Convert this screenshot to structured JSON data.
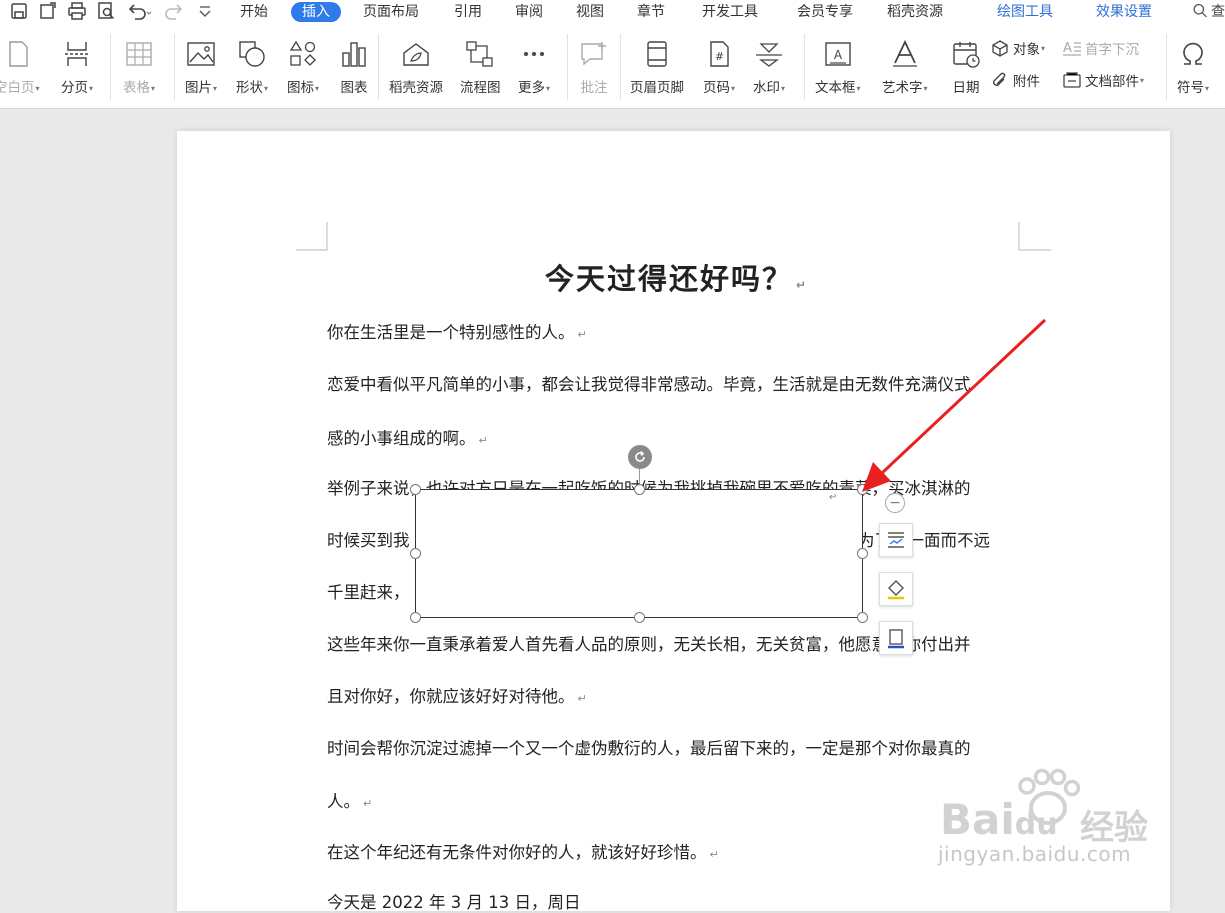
{
  "tabs": [
    "开始",
    "插入",
    "页面布局",
    "引用",
    "审阅",
    "视图",
    "章节",
    "开发工具",
    "会员专享",
    "稻壳资源",
    "绘图工具",
    "效果设置"
  ],
  "active_tab": "插入",
  "search_fragment": "查",
  "ribbon": {
    "blank_page": "空白页",
    "page_break": "分页",
    "table": "表格",
    "picture": "图片",
    "shape": "形状",
    "icon": "图标",
    "chart": "图表",
    "daoke": "稻壳资源",
    "flowchart": "流程图",
    "more": "更多",
    "comment": "批注",
    "header_footer": "页眉页脚",
    "page_number": "页码",
    "watermark": "水印",
    "textbox": "文本框",
    "wordart": "艺术字",
    "date": "日期",
    "object": "对象",
    "attachment": "附件",
    "drop_cap": "首字下沉",
    "doc_parts": "文档部件",
    "symbol": "符号"
  },
  "document": {
    "title": "今天过得还好吗？",
    "paragraphs": [
      "你在生活里是一个特别感性的人。",
      "恋爱中看似平凡简单的小事，都会让我觉得非常感动。毕竟，生活就是由无数件充满仪式",
      "感的小事组成的啊。",
      "举例子来说，也许对方只是在一起吃饭的时候为我挑掉我碗里不爱吃的青菜，买冰淇淋的",
      "时候买到我",
      "为了我一面而不远",
      "千里赶来，",
      "这些年来你一直秉承着爱人首先看人品的原则，无关长相，无关贫富，他愿意为你付出并",
      "且对你好，你就应该好好对待他。",
      "时间会帮你沉淀过滤掉一个又一个虚伪敷衍的人，最后留下来的，一定是那个对你最真的",
      "人。",
      "在这个年纪还有无条件对你好的人，就该好好珍惜。",
      "今天是 2022 年 3 月 13 日，周日"
    ]
  },
  "watermark": {
    "logo": "Bai",
    "logo_tail": "du",
    "cn": "经验",
    "url": "jingyan.baidu.com"
  }
}
